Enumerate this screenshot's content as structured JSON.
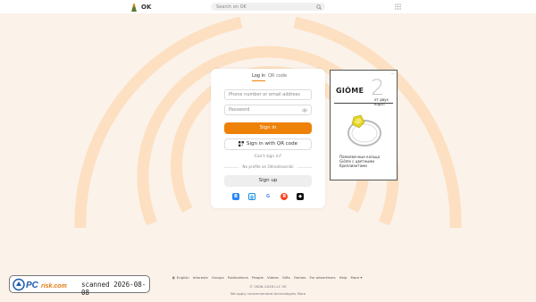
{
  "header": {
    "logo_text": "OK",
    "search_placeholder": "Search on OK"
  },
  "login": {
    "tabs": [
      "Log in",
      "QR code"
    ],
    "phone_placeholder": "Phone number or email address",
    "password_placeholder": "Password",
    "sign_in": "Sign in",
    "sign_in_qr": "Sign in with QR code",
    "cant_sign_in": "Can't sign in?",
    "no_profile": "No profile on Odnoklassniki",
    "sign_up": "Sign up",
    "socials": [
      "vk",
      "mail",
      "google",
      "yandex",
      "apple"
    ]
  },
  "ad": {
    "brand": "GIÓME",
    "number": "2",
    "subtitle": "от двух карат",
    "text": "Помолвочные кольца Gióme с цветными бриллиантами"
  },
  "footer": {
    "links": [
      "English",
      "Interests",
      "Groups",
      "Publications",
      "People",
      "Videos",
      "Gifts",
      "Games",
      "For advertisers",
      "Help",
      "More"
    ],
    "copyright": "© 2006–2026 LLC VK",
    "apply": "We apply recommended technologies More"
  },
  "stamp": {
    "brand": "PCrisk.com",
    "text": "scanned 2026-08-08"
  },
  "colors": {
    "accent": "#ee8208",
    "background": "#fbf2ea"
  }
}
